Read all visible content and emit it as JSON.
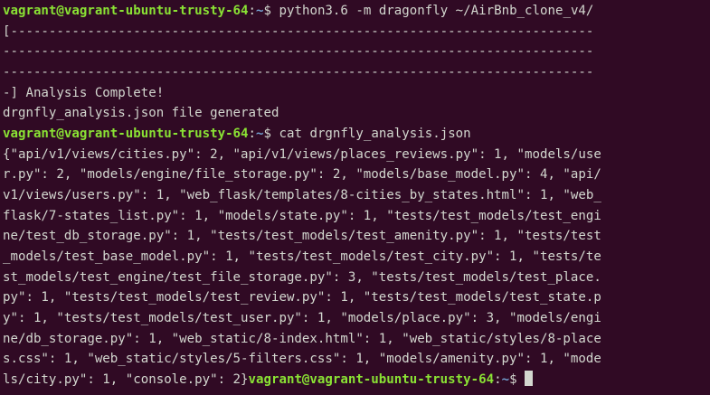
{
  "terminal": {
    "prompt_user_host": "vagrant@vagrant-ubuntu-trusty-64",
    "prompt_path_sep": ":",
    "prompt_path": "~",
    "prompt_symbol": "$ ",
    "command_1": "python3.6 -m dragonfly ~/AirBnb_clone_v4/",
    "progress_lines": [
      "[----------------------------------------------------------------------------",
      "-----------------------------------------------------------------------------",
      "-----------------------------------------------------------------------------",
      "-] Analysis Complete!"
    ],
    "generated_message": "drgnfly_analysis.json file generated",
    "command_2": "cat drgnfly_analysis.json",
    "json_output_lines": [
      "{\"api/v1/views/cities.py\": 2, \"api/v1/views/places_reviews.py\": 1, \"models/use",
      "r.py\": 2, \"models/engine/file_storage.py\": 2, \"models/base_model.py\": 4, \"api/",
      "v1/views/users.py\": 1, \"web_flask/templates/8-cities_by_states.html\": 1, \"web_",
      "flask/7-states_list.py\": 1, \"models/state.py\": 1, \"tests/test_models/test_engi",
      "ne/test_db_storage.py\": 1, \"tests/test_models/test_amenity.py\": 1, \"tests/test",
      "_models/test_base_model.py\": 1, \"tests/test_models/test_city.py\": 1, \"tests/te",
      "st_models/test_engine/test_file_storage.py\": 3, \"tests/test_models/test_place.",
      "py\": 1, \"tests/test_models/test_review.py\": 1, \"tests/test_models/test_state.p",
      "y\": 1, \"tests/test_models/test_user.py\": 1, \"models/place.py\": 3, \"models/engi",
      "ne/db_storage.py\": 1, \"web_static/8-index.html\": 1, \"web_static/styles/8-place",
      "s.css\": 1, \"web_static/styles/5-filters.css\": 1, \"models/amenity.py\": 1, \"mode",
      "ls/city.py\": 1, \"console.py\": 2}"
    ]
  },
  "colors": {
    "background": "#300a24",
    "text": "#d3d7cf",
    "prompt_user": "#8ae234",
    "prompt_path": "#729fcf"
  }
}
